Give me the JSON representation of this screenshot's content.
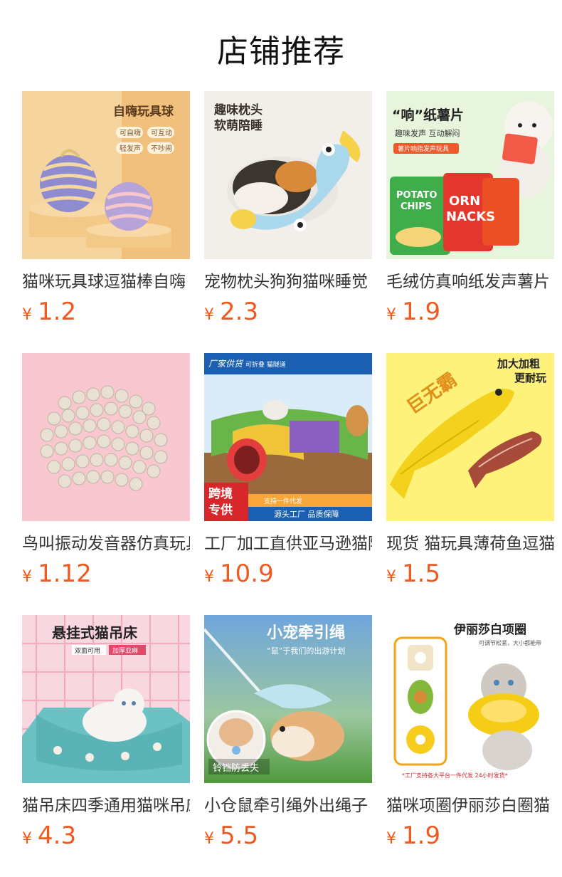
{
  "section": {
    "title": "店铺推荐"
  },
  "products": [
    {
      "name": "猫咪玩具球逗猫棒自嗨",
      "currency": "¥",
      "price": "1.2",
      "image": {
        "bg": "#f3c98a",
        "headline": "自嗨玩具球",
        "tags": [
          "可自嗨",
          "可互动",
          "轻发声",
          "不吵闹"
        ]
      }
    },
    {
      "name": "宠物枕头狗狗猫咪睡觉",
      "currency": "¥",
      "price": "2.3",
      "image": {
        "bg": "#f2eee9",
        "headline": "趣味枕头",
        "subline": "软萌陪睡"
      }
    },
    {
      "name": "毛绒仿真响纸发声薯片",
      "currency": "¥",
      "price": "1.9",
      "image": {
        "bg": "#e6f5dc",
        "headline": "“响”纸薯片",
        "subline": "趣味发声 互动解闷",
        "tag": "薯片响指发声玩具",
        "bag1": "POTATO CHIPS",
        "bag2": "CORN SNACKS"
      }
    },
    {
      "name": "鸟叫振动发音器仿真玩具",
      "currency": "¥",
      "price": "1.12",
      "image": {
        "bg": "#f8c7cf"
      }
    },
    {
      "name": "工厂加工直供亚马逊猫隧道",
      "currency": "¥",
      "price": "10.9",
      "image": {
        "bg": "#d9ecf7",
        "badge": "厂家供货",
        "badge2": "可折叠 猫隧道",
        "strip1": "跨境",
        "strip2": "专供",
        "footer1": "支持一件代发",
        "footer2": "源头工厂 品质保障"
      }
    },
    {
      "name": "现货 猫玩具薄荷鱼逗猫",
      "currency": "¥",
      "price": "1.5",
      "image": {
        "bg": "#fff27a",
        "headline": "加大加粗",
        "subline": "更耐玩",
        "big": "巨无霸"
      }
    },
    {
      "name": "猫吊床四季通用猫咪吊床",
      "currency": "¥",
      "price": "4.3",
      "image": {
        "bg": "#f9d7e0",
        "headline": "悬挂式猫吊床",
        "tag1": "双面可用",
        "tag2": "加厚亚麻"
      }
    },
    {
      "name": "小仓鼠牵引绳外出绳子",
      "currency": "¥",
      "price": "5.5",
      "image": {
        "bg": "#7fb2e0",
        "headline": "小宠牵引绳",
        "subline": "“鼠”于我们的出游计划",
        "caption": "铃铛防丢失"
      }
    },
    {
      "name": "猫咪项圈伊丽莎白圈猫",
      "currency": "¥",
      "price": "1.9",
      "image": {
        "bg": "#ffffff",
        "headline": "伊丽莎白项圈",
        "subline": "可调节松紧，大小都能带",
        "footer": "*工厂支持各大平台一件代发 24小时发货*"
      }
    }
  ]
}
